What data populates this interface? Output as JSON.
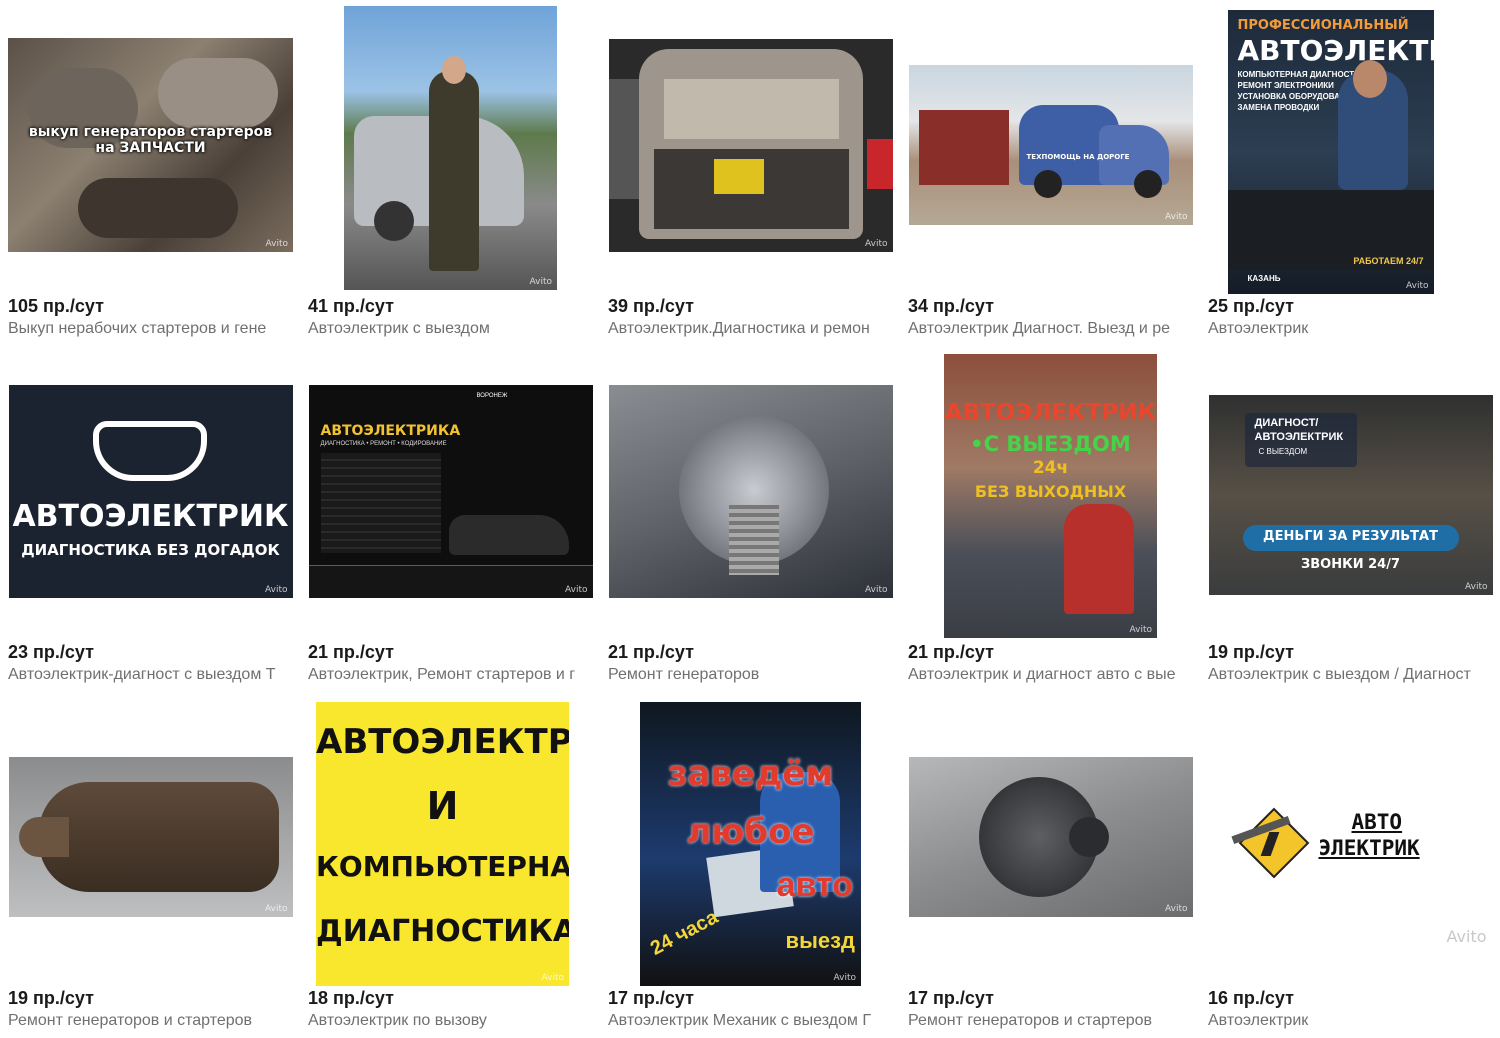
{
  "watermark": "Avito",
  "listings": [
    {
      "stat": "105 пр./сут",
      "title": "Выкуп нерабочих стартеров и гене",
      "image_caption": "выкуп генераторов стартеров на ЗАПЧАСТИ"
    },
    {
      "stat": "41 пр./сут",
      "title": "Автоэлектрик с выездом"
    },
    {
      "stat": "39 пр./сут",
      "title": "Автоэлектрик.Диагностика и ремон"
    },
    {
      "stat": "34 пр./сут",
      "title": "Автоэлектрик Диагност. Выезд и ре",
      "image_caption": "ТЕХПОМОЩЬ НА ДОРОГЕ"
    },
    {
      "stat": "25 пр./сут",
      "title": "Автоэлектрик",
      "image_lines": [
        "ПРОФЕССИОНАЛЬНЫЙ",
        "АВТОЭЛЕКТРИК",
        "КОМПЬЮТЕРНАЯ ДИАГНОСТИКА",
        "РЕМОНТ ЭЛЕКТРОНИКИ",
        "УСТАНОВКА ОБОРУДОВАНИЯ",
        "ЗАМЕНА ПРОВОДКИ",
        "РАБОТАЕМ 24/7",
        "КАЗАНЬ"
      ]
    },
    {
      "stat": "23 пр./сут",
      "title": "Автоэлектрик-диагност с выездом Т",
      "image_lines": [
        "АВТОЭЛЕКТРИК",
        "ДИАГНОСТИКА БЕЗ ДОГАДОК"
      ]
    },
    {
      "stat": "21 пр./сут",
      "title": "Автоэлектрик, Ремонт стартеров и г",
      "image_lines": [
        "АВТОЭЛЕКТРИКА",
        "ДИАГНОСТИКА • РЕМОНТ • КОДИРОВАНИЕ",
        "ВОРОНЕЖ"
      ]
    },
    {
      "stat": "21 пр./сут",
      "title": "Ремонт генераторов"
    },
    {
      "stat": "21 пр./сут",
      "title": "Автоэлектрик и диагност авто с вые",
      "image_lines": [
        "АВТОЭЛЕКТРИК",
        "•С ВЫЕЗДОМ",
        "24ч",
        "БЕЗ ВЫХОДНЫХ"
      ]
    },
    {
      "stat": "19 пр./сут",
      "title": "Автоэлектрик с выездом / Диагност",
      "image_lines": [
        "ДИАГНОСТ/",
        "АВТОЭЛЕКТРИК",
        "С ВЫЕЗДОМ",
        "ДЕНЬГИ ЗА РЕЗУЛЬТАТ",
        "ЗВОНКИ 24/7"
      ]
    },
    {
      "stat": "19 пр./сут",
      "title": "Ремонт генераторов и стартеров"
    },
    {
      "stat": "18 пр./сут",
      "title": "Автоэлектрик по вызову",
      "image_lines": [
        "АВТОЭЛЕКТРИК",
        "И",
        "КОМПЬЮТЕРНАЯ",
        "ДИАГНОСТИКА"
      ]
    },
    {
      "stat": "17 пр./сут",
      "title": "Автоэлектрик Механик с выездом Г",
      "image_lines": [
        "заведём",
        "любое",
        "авто",
        "24 часа",
        "выезд"
      ]
    },
    {
      "stat": "17 пр./сут",
      "title": "Ремонт генераторов и стартеров"
    },
    {
      "stat": "16 пр./сут",
      "title": "Автоэлектрик",
      "image_lines": [
        "АВТО",
        "ЭЛЕКТРИК"
      ]
    }
  ]
}
